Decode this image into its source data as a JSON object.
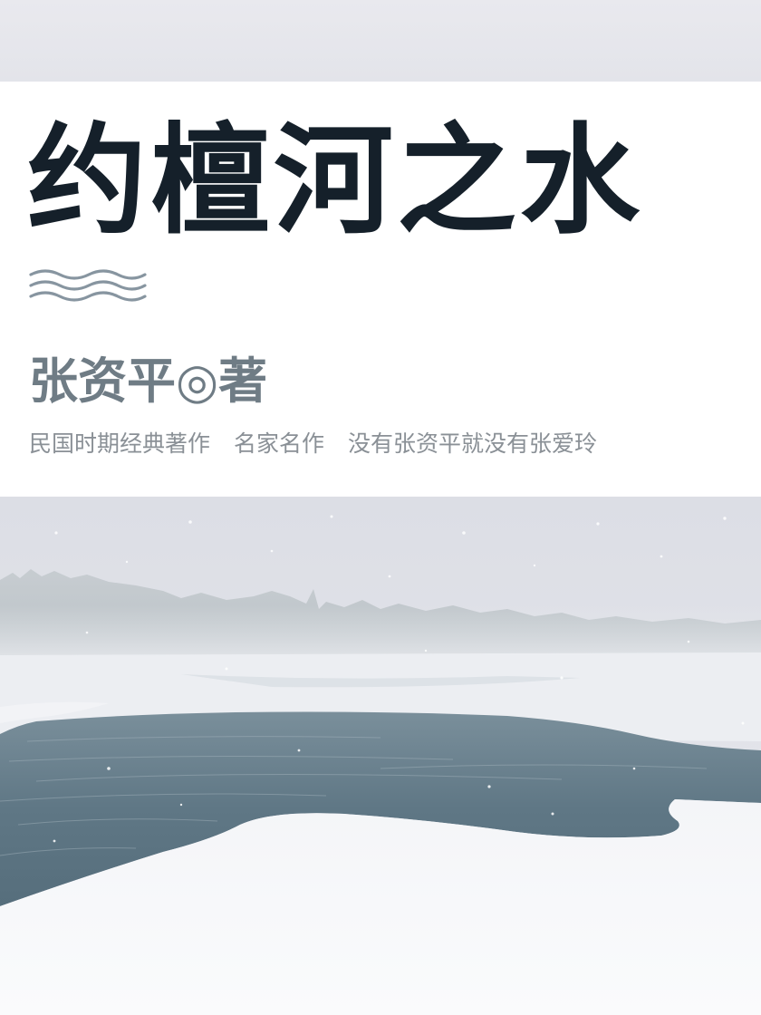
{
  "cover": {
    "title": "约檀河之水",
    "author_credit": "张资平◎著",
    "taglines": [
      "民国时期经典著作",
      "名家名作",
      "没有张资平就没有张爱玲"
    ]
  },
  "colors": {
    "title": "#15202a",
    "author": "#6f7c85",
    "tagline": "#8a9096",
    "waves": "#8795a0",
    "water": "#5f7785",
    "snow": "#f7f8fa",
    "sky": "#e2e4ea"
  },
  "icons": {
    "divider": "waves-icon"
  }
}
